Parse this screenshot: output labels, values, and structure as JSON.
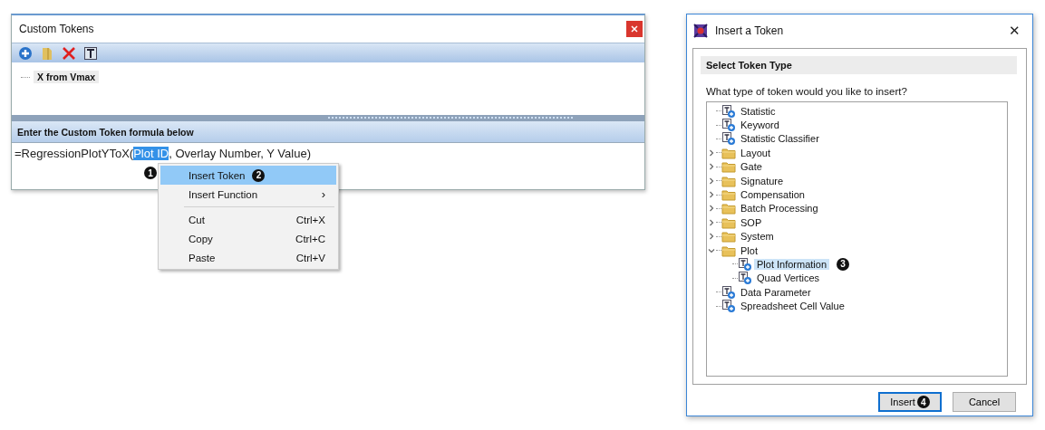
{
  "custom_tokens_window": {
    "title": "Custom Tokens",
    "toolbar": [
      {
        "kind": "add"
      },
      {
        "kind": "folder"
      },
      {
        "kind": "delete"
      },
      {
        "kind": "text"
      }
    ],
    "tokens": [
      {
        "label": "X from Vmax",
        "selected": true
      }
    ],
    "formula_header": "Enter the Custom Token formula below",
    "formula": {
      "before": "=RegressionPlotYToX(",
      "selected_text": "Plot ID",
      "after": ", Overlay Number, Y Value)",
      "callout": "1"
    }
  },
  "context_menu": {
    "items": [
      {
        "kind": "item",
        "label": "Insert Token",
        "selected": true,
        "callout": "2"
      },
      {
        "kind": "submenu",
        "label": "Insert Function",
        "selected": false,
        "arrow": "›"
      },
      {
        "kind": "separator"
      },
      {
        "kind": "item",
        "label": "Cut",
        "shortcut": "Ctrl+X",
        "selected": false
      },
      {
        "kind": "item",
        "label": "Copy",
        "shortcut": "Ctrl+C",
        "selected": false
      },
      {
        "kind": "item",
        "label": "Paste",
        "shortcut": "Ctrl+V",
        "selected": false
      }
    ]
  },
  "insert_token_dialog": {
    "title": "Insert a Token",
    "close": "✕",
    "section": "Select Token Type",
    "question": "What type of token would you like to insert?",
    "tree": [
      {
        "kind": "token",
        "label": "Statistic",
        "selected": false
      },
      {
        "kind": "token",
        "label": "Keyword",
        "selected": false
      },
      {
        "kind": "token",
        "label": "Statistic Classifier",
        "selected": false
      },
      {
        "kind": "folder",
        "label": "Layout",
        "expanded": false,
        "selected": false
      },
      {
        "kind": "folder",
        "label": "Gate",
        "expanded": false,
        "selected": false
      },
      {
        "kind": "folder",
        "label": "Signature",
        "expanded": false,
        "selected": false
      },
      {
        "kind": "folder",
        "label": "Compensation",
        "expanded": false,
        "selected": false
      },
      {
        "kind": "folder",
        "label": "Batch Processing",
        "expanded": false,
        "selected": false
      },
      {
        "kind": "folder",
        "label": "SOP",
        "expanded": false,
        "selected": false
      },
      {
        "kind": "folder",
        "label": "System",
        "expanded": false,
        "selected": false
      },
      {
        "kind": "folder",
        "label": "Plot",
        "expanded": true,
        "selected": false,
        "children": [
          {
            "kind": "token",
            "label": "Plot Information",
            "selected": true,
            "callout": "3"
          },
          {
            "kind": "token",
            "label": "Quad Vertices",
            "selected": false
          }
        ]
      },
      {
        "kind": "token",
        "label": "Data Parameter",
        "selected": false
      },
      {
        "kind": "token",
        "label": "Spreadsheet Cell Value",
        "selected": false
      }
    ],
    "buttons": [
      {
        "label": "Insert",
        "default": true,
        "callout": "4"
      },
      {
        "label": "Cancel",
        "default": false
      }
    ]
  }
}
